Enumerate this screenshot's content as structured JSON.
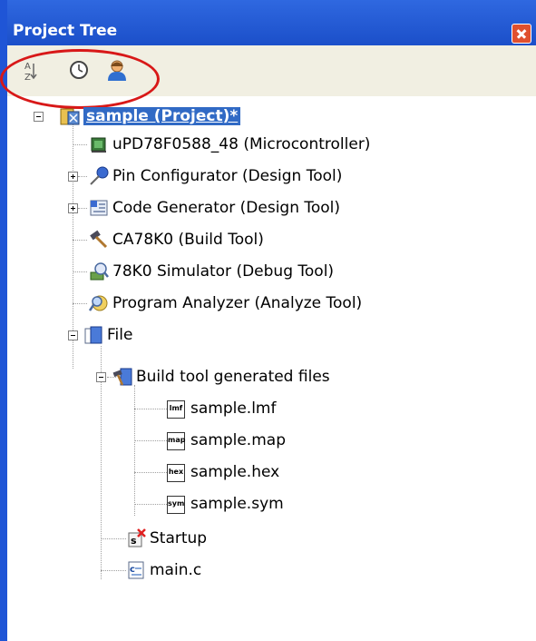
{
  "panel": {
    "title": "Project Tree"
  },
  "toolbar": {
    "buttons": [
      {
        "icon": "sort-az-icon"
      },
      {
        "icon": "clock-icon"
      },
      {
        "icon": "person-icon"
      }
    ]
  },
  "tree": {
    "nodes": [
      {
        "label": "sample (Project)*",
        "icon": "project-icon",
        "selected": true,
        "expanded": true
      },
      {
        "label": "uPD78F0588_48 (Microcontroller)",
        "icon": "chip-icon"
      },
      {
        "label": "Pin Configurator (Design Tool)",
        "icon": "pin-icon",
        "expandable": true
      },
      {
        "label": "Code Generator (Design Tool)",
        "icon": "code-generator-icon",
        "expandable": true
      },
      {
        "label": "CA78K0 (Build Tool)",
        "icon": "hammer-icon"
      },
      {
        "label": "78K0 Simulator (Debug Tool)",
        "icon": "simulator-icon"
      },
      {
        "label": "Program Analyzer (Analyze Tool)",
        "icon": "analyzer-icon"
      },
      {
        "label": "File",
        "icon": "folder-icon",
        "expanded": true
      },
      {
        "label": "Build tool generated files",
        "icon": "build-folder-icon",
        "expanded": true
      },
      {
        "label": "sample.lmf",
        "icon": "lmf-file-icon",
        "tag": "lmf"
      },
      {
        "label": "sample.map",
        "icon": "map-file-icon",
        "tag": "map"
      },
      {
        "label": "sample.hex",
        "icon": "hex-file-icon",
        "tag": "hex"
      },
      {
        "label": "sample.sym",
        "icon": "sym-file-icon",
        "tag": "sym"
      },
      {
        "label": "Startup",
        "icon": "startup-icon"
      },
      {
        "label": "main.c",
        "icon": "c-file-icon"
      }
    ]
  },
  "colors": {
    "title_bar": "#1b4fc9",
    "selection": "#316ac5",
    "highlight_oval": "#d81818",
    "toolbar": "#f1efe2"
  }
}
